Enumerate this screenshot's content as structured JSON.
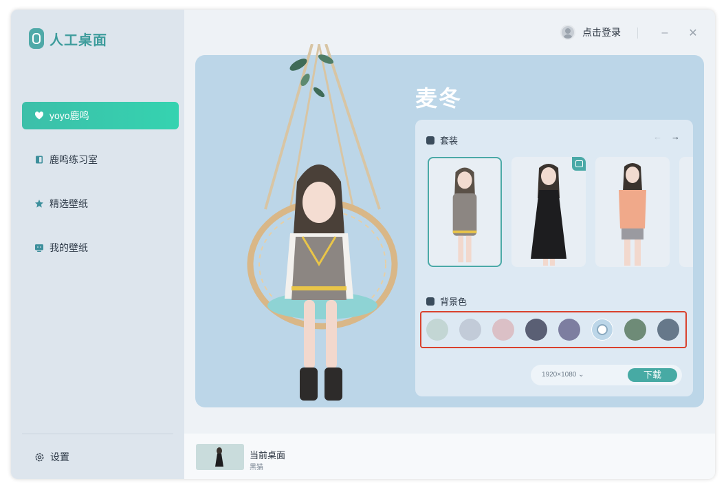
{
  "app": {
    "name": "人工桌面"
  },
  "sidebar": {
    "items": [
      {
        "label": "yoyo鹿鸣",
        "icon": "heart-icon",
        "active": true
      },
      {
        "label": "鹿鸣练习室",
        "icon": "door-icon",
        "active": false
      },
      {
        "label": "精选壁纸",
        "icon": "star-icon",
        "active": false
      },
      {
        "label": "我的壁纸",
        "icon": "monitor-icon",
        "active": false
      }
    ],
    "settings_label": "设置"
  },
  "titlebar": {
    "login_label": "点击登录",
    "minimize": "–",
    "close": "✕"
  },
  "hero": {
    "title": "麦冬",
    "outfits": {
      "title": "套装",
      "prev": "←",
      "next": "→",
      "items": [
        {
          "name": "vest-outfit",
          "selected": true
        },
        {
          "name": "black-dress-outfit",
          "selected": false,
          "badge": "monitor-badge-icon"
        },
        {
          "name": "peach-tshirt-outfit",
          "selected": false
        }
      ]
    },
    "background_color": {
      "title": "背景色",
      "swatches": [
        "#c3d6d4",
        "#c2cbd8",
        "#dbc0c6",
        "#5a5f74",
        "#7d7ea0",
        "#bcd6e8",
        "#6e8b77",
        "#66788a"
      ],
      "selected_index": 5
    },
    "download": {
      "resolution": "1920×1080",
      "button_label": "下载"
    }
  },
  "bottom": {
    "current_label": "当前桌面",
    "current_name": "黑猫"
  },
  "colors": {
    "accent": "#3cbfa9",
    "highlight_border": "#d9412c",
    "hero_bg": "#bcd6e8"
  }
}
